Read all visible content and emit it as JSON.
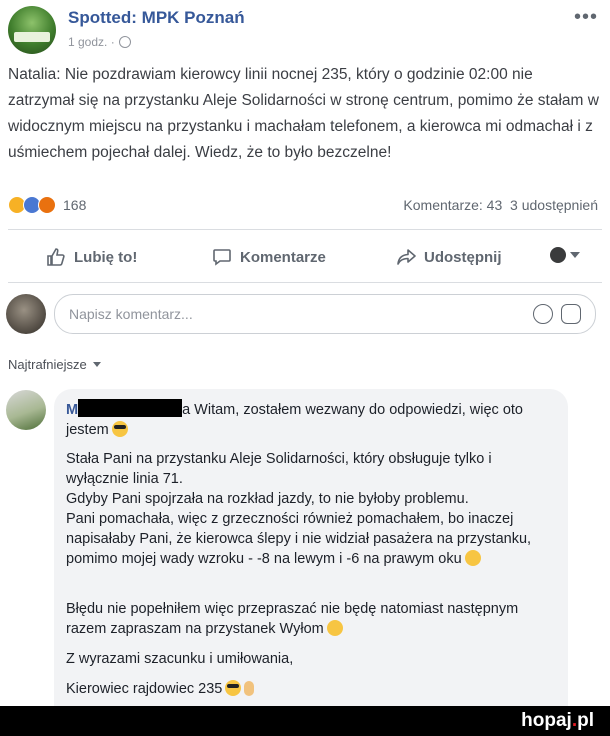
{
  "post": {
    "page_name": "Spotted: MPK Poznań",
    "time": "1 godz. ·",
    "more_icon": "more-horizontal-icon",
    "text": "Natalia: Nie pozdrawiam kierowcy linii nocnej 235, który o godzinie 02:00 nie zatrzymał się na przystanku Aleje Solidarności w stronę centrum, pomimo że stałam w widocznym miejscu na przystanku i machałam telefonem, a kierowca mi odmachał i z uśmiechem pojechał dalej. Wiedz, że to było bezczelne!",
    "reactions": {
      "types": [
        "haha",
        "like",
        "angry"
      ],
      "count": "168"
    },
    "comments_count": "Komentarze: 43",
    "shares_count": "3 udostępnień"
  },
  "actions": {
    "like": "Lubię to!",
    "comment": "Komentarze",
    "share": "Udostępnij"
  },
  "composer": {
    "placeholder": "Napisz komentarz..."
  },
  "sort": {
    "label": "Najtrafniejsze"
  },
  "comment": {
    "author_visible": "M",
    "lines": [
      "a Witam, zostałem wezwany do odpowiedzi, więc oto jestem",
      "Stała Pani na przystanku Aleje Solidarności, który obsługuje tylko i wyłącznie linia 71.",
      "Gdyby Pani spojrzała na rozkład jazdy, to nie byłoby problemu.",
      "Pani pomachała, więc z grzeczności również pomachałem, bo inaczej napisałaby Pani, że kierowca ślepy i nie widział pasażera na przystanku, pomimo mojej wady wzroku - -8 na lewym i -6 na prawym oku",
      "Błędu nie popełniłem więc przepraszać nie będę natomiast następnym razem zapraszam na przystanek Wyłom",
      "Z wyrazami szacunku i umiłowania,",
      "Kierowiec rajdowiec 235"
    ]
  },
  "watermark": {
    "site": "hopaj",
    "dot": ".",
    "tld": "pl"
  }
}
